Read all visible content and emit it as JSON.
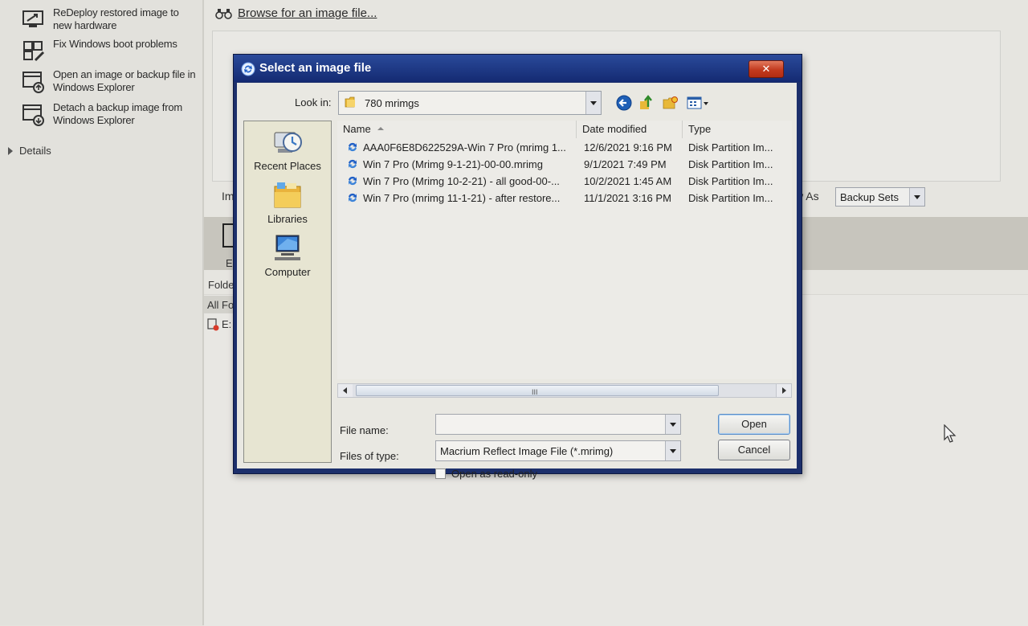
{
  "sidebar": {
    "tasks": [
      {
        "label": "ReDeploy restored image to new hardware",
        "icon": "redeploy-icon"
      },
      {
        "label": "Fix Windows boot problems",
        "icon": "boot-repair-icon"
      },
      {
        "label": "Open an image or backup file in Windows Explorer",
        "icon": "open-image-icon"
      },
      {
        "label": "Detach a backup image from Windows Explorer",
        "icon": "detach-image-icon"
      }
    ],
    "details_label": "Details"
  },
  "main": {
    "browse_link": "Browse for an image file...",
    "view_as_label": "w As",
    "view_as_value": "Backup Sets",
    "fragments": {
      "im": "Im",
      "e": "E",
      "folde": "Folde",
      "all_fo": "All Fo",
      "e_colon": "E:"
    }
  },
  "dialog": {
    "title": "Select an image file",
    "close_label": "✕",
    "look_in_label": "Look in:",
    "look_in_value": "780 mrimgs",
    "places": [
      {
        "label": "Recent Places",
        "icon": "recent-places-icon"
      },
      {
        "label": "Libraries",
        "icon": "libraries-icon"
      },
      {
        "label": "Computer",
        "icon": "computer-icon"
      }
    ],
    "columns": {
      "name": "Name",
      "date": "Date modified",
      "type": "Type"
    },
    "files": [
      {
        "name": "AAA0F6E8D622529A-Win 7 Pro (mrimg 1...",
        "date": "12/6/2021 9:16 PM",
        "type": "Disk Partition Im..."
      },
      {
        "name": "Win 7 Pro (Mrimg 9-1-21)-00-00.mrimg",
        "date": "9/1/2021 7:49 PM",
        "type": "Disk Partition Im..."
      },
      {
        "name": "Win 7 Pro (Mrimg 10-2-21) - all good-00-...",
        "date": "10/2/2021 1:45 AM",
        "type": "Disk Partition Im..."
      },
      {
        "name": "Win 7 Pro (mrimg 11-1-21) - after restore...",
        "date": "11/1/2021 3:16 PM",
        "type": "Disk Partition Im..."
      }
    ],
    "scroll_grip": "III",
    "file_name_label": "File name:",
    "file_name_value": "",
    "files_of_type_label": "Files of type:",
    "files_of_type_value": "Macrium Reflect Image File (*.mrimg)",
    "open_label": "Open",
    "cancel_label": "Cancel",
    "readonly_label": "Open as read-only"
  },
  "colors": {
    "title_bar": "#1c2f6b",
    "close_button": "#c23a1e",
    "places_bg": "#e7e5d2"
  }
}
